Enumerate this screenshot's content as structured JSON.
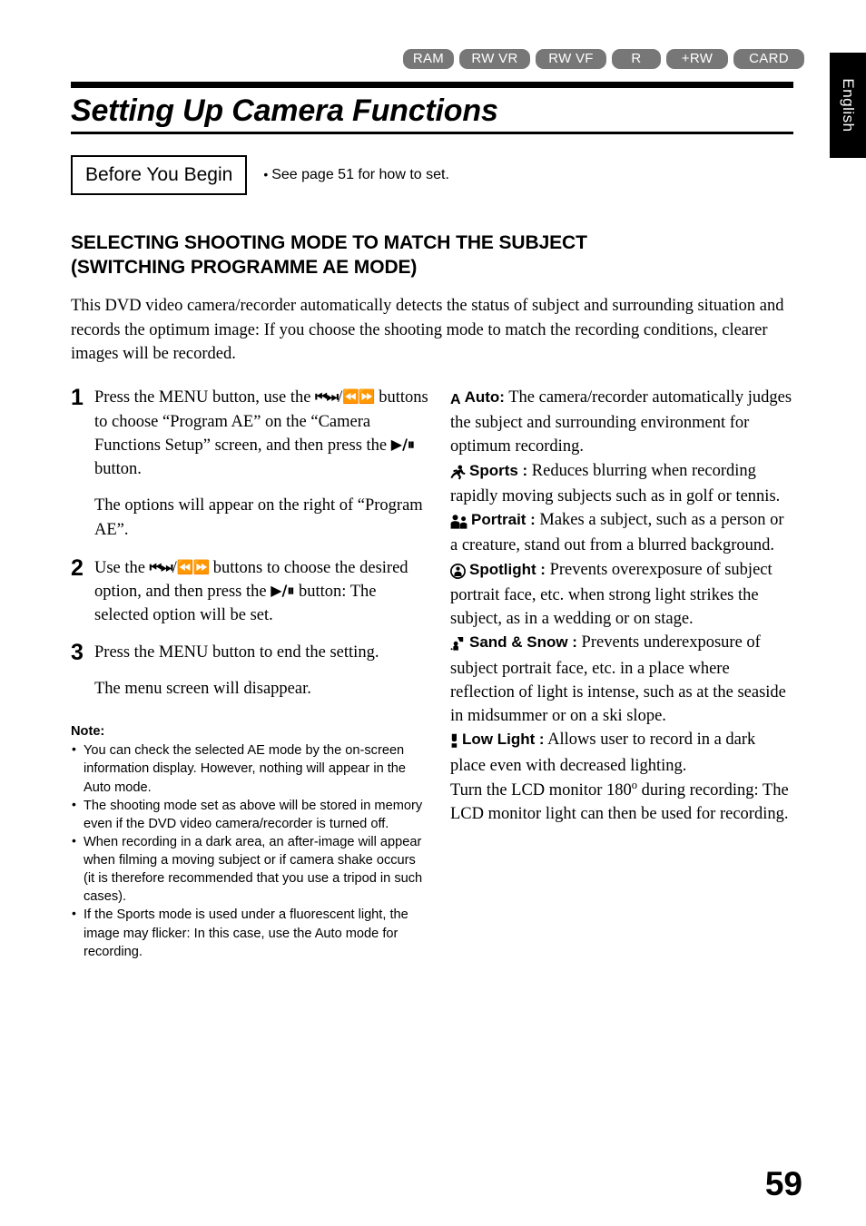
{
  "media_badges": [
    {
      "label": "RAM",
      "cls": "w-ram"
    },
    {
      "label": "RW VR",
      "cls": "w-rwvr"
    },
    {
      "label": "RW VF",
      "cls": "w-rwvf"
    },
    {
      "label": "R",
      "cls": "w-r"
    },
    {
      "label": "+RW",
      "cls": "w-prw"
    },
    {
      "label": "CARD",
      "cls": "w-card"
    }
  ],
  "language_tab": "English",
  "title": "Setting Up Camera Functions",
  "before_you_begin": {
    "box_label": "Before You Begin",
    "bullet": "See page 51 for how to set."
  },
  "section": {
    "heading_line1": "SELECTING SHOOTING MODE TO MATCH THE SUBJECT",
    "heading_line2": "(SWITCHING PROGRAMME AE MODE)",
    "intro": "This DVD video camera/recorder automatically detects the status of subject and surrounding situation and records the optimum image: If you choose the shooting mode to match the recording conditions, clearer images will be recorded."
  },
  "steps": [
    {
      "number": "1",
      "text_a": "Press the MENU button, use the ",
      "glyph_1": "⏮⏭",
      "sep_1": "/",
      "glyph_2": "⏪⏩",
      "text_b": " buttons to choose “Program AE” on the “Camera Functions Setup” screen, and then press the ",
      "glyph_3": "▶/⏸",
      "text_c": " button.",
      "sub": "The options will appear on the right of “Program AE”."
    },
    {
      "number": "2",
      "text_a": "Use the ",
      "glyph_1": "⏮⏭",
      "sep_1": "/",
      "glyph_2": "⏪⏩",
      "text_b": " buttons to choose the desired option, and then press the ",
      "glyph_3": "▶/⏸",
      "text_c": " button: The selected option will be set.",
      "sub": ""
    },
    {
      "number": "3",
      "text_a": "Press the MENU button to end the setting.",
      "glyph_1": "",
      "sep_1": "",
      "glyph_2": "",
      "text_b": "",
      "glyph_3": "",
      "text_c": "",
      "sub": "The menu screen will disappear."
    }
  ],
  "note": {
    "title": "Note:",
    "items": [
      "You can check the selected AE mode by the on-screen information display. However, nothing will appear in the Auto mode.",
      "The shooting mode set as above will be stored in memory even if the DVD video camera/recorder is turned off.",
      "When recording in a dark area, an after-image will appear when filming a moving subject or if camera shake occurs (it is therefore recommended that you use a tripod in such cases).",
      "If the Sports mode is used under a fluorescent light, the image may flicker: In this case, use the Auto mode for recording."
    ]
  },
  "modes": [
    {
      "icon": "letter-a-icon",
      "name": "Auto",
      "colon": ":",
      "description": "The camera/recorder automatically judges the subject and surrounding environment for optimum recording."
    },
    {
      "icon": "running-person-icon",
      "name": "Sports",
      "colon": ":",
      "description": "Reduces blurring when recording rapidly moving subjects such as in golf or tennis."
    },
    {
      "icon": "two-people-icon",
      "name": "Portrait",
      "colon": ":",
      "description": "Makes a subject, such as a person or a creature, stand out from a blurred background."
    },
    {
      "icon": "spotlight-icon",
      "name": "Spotlight",
      "colon": ":",
      "description": "Prevents overexposure of subject portrait face, etc. when strong light strikes the subject, as in a wedding or on stage."
    },
    {
      "icon": "sand-snow-icon",
      "name": "Sand & Snow",
      "colon": ":",
      "description": "Prevents underexposure of subject portrait face, etc. in a place where reflection of light is intense, such as at the seaside in midsummer or on a ski slope."
    },
    {
      "icon": "low-light-icon",
      "name": "Low Light",
      "colon": ":",
      "description": "Allows user to record in a dark place even with decreased lighting."
    }
  ],
  "modes_tail": {
    "part1": "Turn the LCD monitor 180",
    "degree": "o",
    "part2": " during recording: The LCD monitor light can then be used for recording."
  },
  "page_number": "59",
  "colors": {
    "badge_bg": "#777777",
    "badge_text": "#ffffff",
    "tab_bg": "#000000",
    "tab_text": "#ffffff",
    "rule": "#000000",
    "text": "#000000"
  }
}
